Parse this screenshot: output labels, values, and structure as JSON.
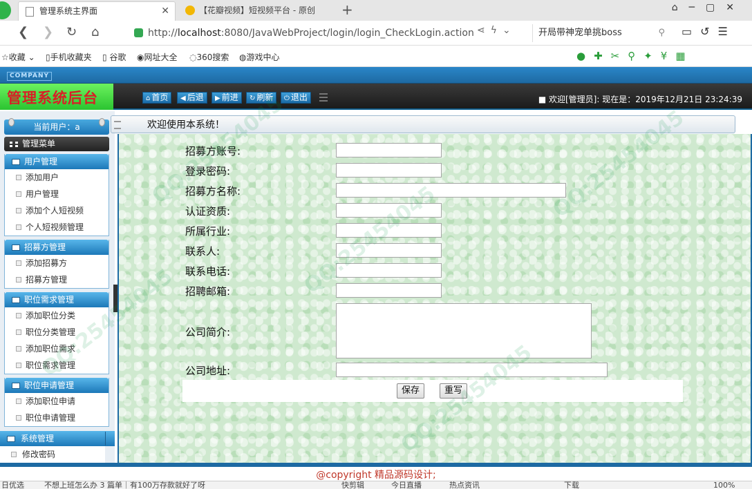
{
  "browser": {
    "tabs": [
      {
        "title": "管理系统主界面",
        "active": true
      },
      {
        "title": "【花瓣视频】短视频平台 - 原创"
      }
    ],
    "url_prefix": "http://",
    "url_host": "localhost",
    "url_rest": ":8080/JavaWebProject/login/login_CheckLogin.action",
    "search_text": "开局带神宠单挑boss",
    "bookmarks": [
      "收藏",
      "手机收藏夹",
      "谷歌",
      "网址大全",
      "360搜索",
      "游戏中心"
    ]
  },
  "header": {
    "company": "COMPANY",
    "brand": "管理系统后台",
    "buttons": [
      "首页",
      "后退",
      "前进",
      "刷新",
      "退出"
    ],
    "welcome": "■ 欢迎[管理员]:  现在是：2019年12月21日 23:24:39"
  },
  "sidebar": {
    "current_user": "当前用户：a",
    "menu_title": "管理菜单",
    "groups": [
      {
        "title": "用户管理",
        "items": [
          "添加用户",
          "用户管理",
          "添加个人短视频",
          "个人短视频管理"
        ]
      },
      {
        "title": "招募方管理",
        "items": [
          "添加招募方",
          "招募方管理"
        ]
      },
      {
        "title": "职位需求管理",
        "items": [
          "添加职位分类",
          "职位分类管理",
          "添加职位需求",
          "职位需求管理"
        ]
      },
      {
        "title": "职位申请管理",
        "items": [
          "添加职位申请",
          "职位申请管理"
        ]
      }
    ],
    "system": {
      "title": "系统管理",
      "items": [
        "修改密码"
      ]
    }
  },
  "main": {
    "title": "欢迎使用本系统！",
    "form": {
      "labels": [
        "招募方账号:",
        "登录密码:",
        "招募方名称:",
        "认证资质:",
        "所属行业:",
        "联系人:",
        "联系电话:",
        "招聘邮箱:",
        "公司简介:",
        "公司地址:"
      ],
      "values": [
        "",
        "",
        "",
        "",
        "",
        "",
        "",
        "",
        "",
        ""
      ],
      "save": "保存",
      "reset": "重写"
    }
  },
  "footer": {
    "copyright": "@copyright 精品源码设计;"
  },
  "statusbar": [
    "日优选",
    "不想上班怎么办 3 篇单｜有100万存款就好了呀",
    "快剪辑",
    "今日直播",
    "热点资讯",
    "下载",
    "100%"
  ],
  "watermark": "QQ:25454045"
}
